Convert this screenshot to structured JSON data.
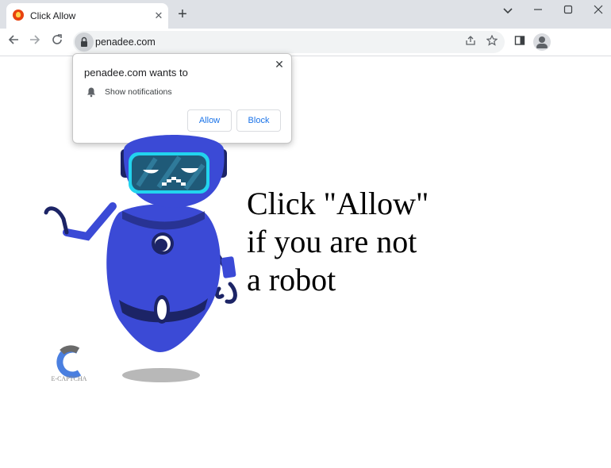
{
  "browser": {
    "tab_title": "Click Allow",
    "tab_close": "✕",
    "new_tab": "+",
    "url": "penadee.com",
    "icons": [
      "favicon-icon",
      "back-icon",
      "forward-icon",
      "reload-icon",
      "lock-icon",
      "share-icon",
      "star-icon",
      "side-panel-icon",
      "profile-icon",
      "minimize-icon",
      "maximize-icon",
      "window-close-icon",
      "chevron-down-icon"
    ]
  },
  "permission_popup": {
    "title": "penadee.com wants to",
    "permission": "Show notifications",
    "allow_label": "Allow",
    "block_label": "Block",
    "close": "✕"
  },
  "page": {
    "headline_lines": [
      "Click \"Allow\"",
      "if you are not",
      "a robot"
    ],
    "captcha_label": "E-CAPTCHA",
    "colors": {
      "robot_body": "#3b4ad6",
      "robot_dark": "#1c2466",
      "visor": "#2a6a8a",
      "accent_blue": "#1a73e8"
    }
  }
}
